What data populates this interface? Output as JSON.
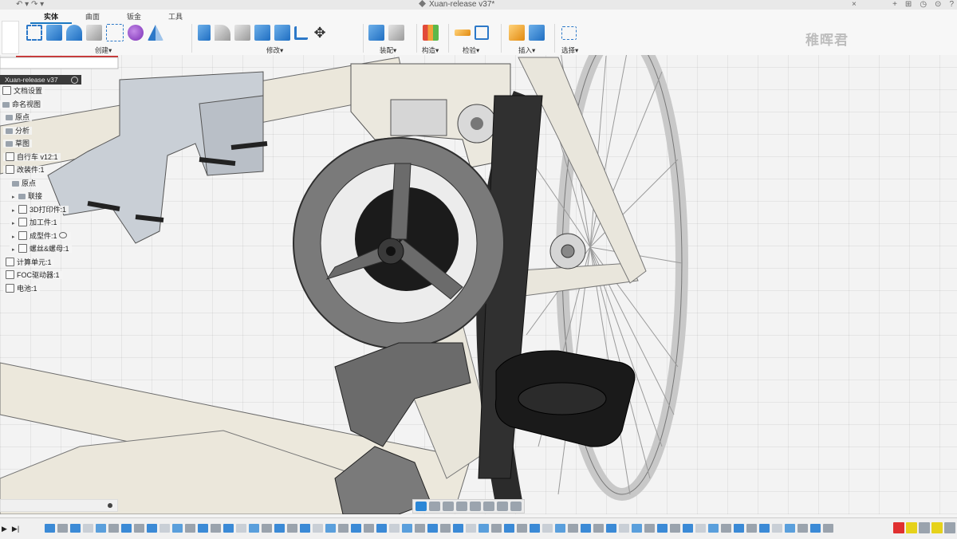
{
  "window": {
    "title": "Xuan-release v37*",
    "undo": "↶ ▾",
    "redo": "↷ ▾",
    "close_doc": "×"
  },
  "ribbon": {
    "tabs": [
      "实体",
      "曲面",
      "钣金",
      "工具"
    ],
    "active_tab": "实体",
    "groups": [
      {
        "label": "创建▾"
      },
      {
        "label": "修改▾"
      },
      {
        "label": "装配▾"
      },
      {
        "label": "构造▾"
      },
      {
        "label": "检验▾"
      },
      {
        "label": "插入▾"
      },
      {
        "label": "选择▾"
      }
    ]
  },
  "watermark": "稚晖君",
  "browser": {
    "document": "Xuan-release v37",
    "nodes": [
      {
        "label": "文档设置",
        "type": "settings",
        "indent": 0
      },
      {
        "label": "命名视图",
        "type": "folder",
        "indent": 0
      },
      {
        "label": "原点",
        "type": "folder",
        "indent": 1
      },
      {
        "label": "分析",
        "type": "folder",
        "indent": 1
      },
      {
        "label": "草图",
        "type": "folder",
        "indent": 1
      },
      {
        "label": "自行车 v12:1",
        "type": "component",
        "indent": 1
      },
      {
        "label": "改装件:1",
        "type": "component",
        "indent": 1
      },
      {
        "label": "原点",
        "type": "folder",
        "indent": 2
      },
      {
        "label": "联接",
        "type": "folder",
        "indent": 2
      },
      {
        "label": "3D打印件:1",
        "type": "component",
        "indent": 2
      },
      {
        "label": "加工件:1",
        "type": "component",
        "indent": 2
      },
      {
        "label": "成型件:1",
        "type": "component",
        "indent": 2
      },
      {
        "label": "螺丝&螺母:1",
        "type": "component",
        "indent": 2
      },
      {
        "label": "计算单元:1",
        "type": "component",
        "indent": 1
      },
      {
        "label": "FOC驱动器:1",
        "type": "component",
        "indent": 1
      },
      {
        "label": "电池:1",
        "type": "component",
        "indent": 1
      }
    ]
  },
  "timeline": {
    "controls": [
      "▶",
      "▶|",
      "⏮"
    ]
  },
  "colors": {
    "accent": "#1a78c2",
    "ground": "#f3f3f3",
    "frame": "#e9e6dc",
    "dark_part": "#3a3a3a"
  }
}
